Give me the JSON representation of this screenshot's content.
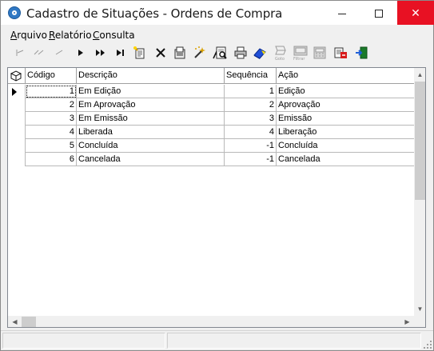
{
  "window": {
    "title": "Cadastro de Situações - Ordens de Compra"
  },
  "menu": [
    {
      "label": "Arquivo",
      "accel": "A",
      "rest": "rquivo"
    },
    {
      "label": "Relatório",
      "accel": "R",
      "rest": "elatório"
    },
    {
      "label": "Consulta",
      "accel": "C",
      "rest": "onsulta"
    }
  ],
  "toolbar": [
    {
      "name": "first-record-icon",
      "enabled": false
    },
    {
      "name": "previous-page-icon",
      "enabled": false
    },
    {
      "name": "previous-record-icon",
      "enabled": false
    },
    {
      "name": "next-record-icon",
      "enabled": true
    },
    {
      "name": "next-page-icon",
      "enabled": true
    },
    {
      "name": "last-record-icon",
      "enabled": true
    },
    {
      "name": "new-record-icon",
      "enabled": true
    },
    {
      "name": "delete-icon",
      "enabled": true
    },
    {
      "name": "edit-record-icon",
      "enabled": true
    },
    {
      "name": "magic-wand-icon",
      "enabled": true
    },
    {
      "name": "sort-icon",
      "enabled": true
    },
    {
      "name": "print-preview-icon",
      "enabled": true
    },
    {
      "name": "print-icon",
      "enabled": true
    },
    {
      "name": "eraser-icon",
      "enabled": true
    },
    {
      "name": "goto-icon",
      "enabled": false,
      "caption": "Goto"
    },
    {
      "name": "filter-icon",
      "enabled": false,
      "caption": "Filtrar"
    },
    {
      "name": "calculator-icon",
      "enabled": false
    },
    {
      "name": "export-icon",
      "enabled": true
    },
    {
      "name": "exit-icon",
      "enabled": true
    }
  ],
  "grid": {
    "columns": [
      "Código",
      "Descrição",
      "Sequência",
      "Ação"
    ],
    "rows": [
      {
        "codigo": "1",
        "descricao": "Em Edição",
        "sequencia": "1",
        "acao": "Edição"
      },
      {
        "codigo": "2",
        "descricao": "Em Aprovação",
        "sequencia": "2",
        "acao": "Aprovação"
      },
      {
        "codigo": "3",
        "descricao": "Em Emissão",
        "sequencia": "3",
        "acao": "Emissão"
      },
      {
        "codigo": "4",
        "descricao": "Liberada",
        "sequencia": "4",
        "acao": "Liberação"
      },
      {
        "codigo": "5",
        "descricao": "Concluída",
        "sequencia": "-1",
        "acao": "Concluída"
      },
      {
        "codigo": "6",
        "descricao": "Cancelada",
        "sequencia": "-1",
        "acao": "Cancelada"
      }
    ],
    "current_row": 0
  },
  "colors": {
    "close_button": "#e81123",
    "grid_border": "#828790"
  }
}
